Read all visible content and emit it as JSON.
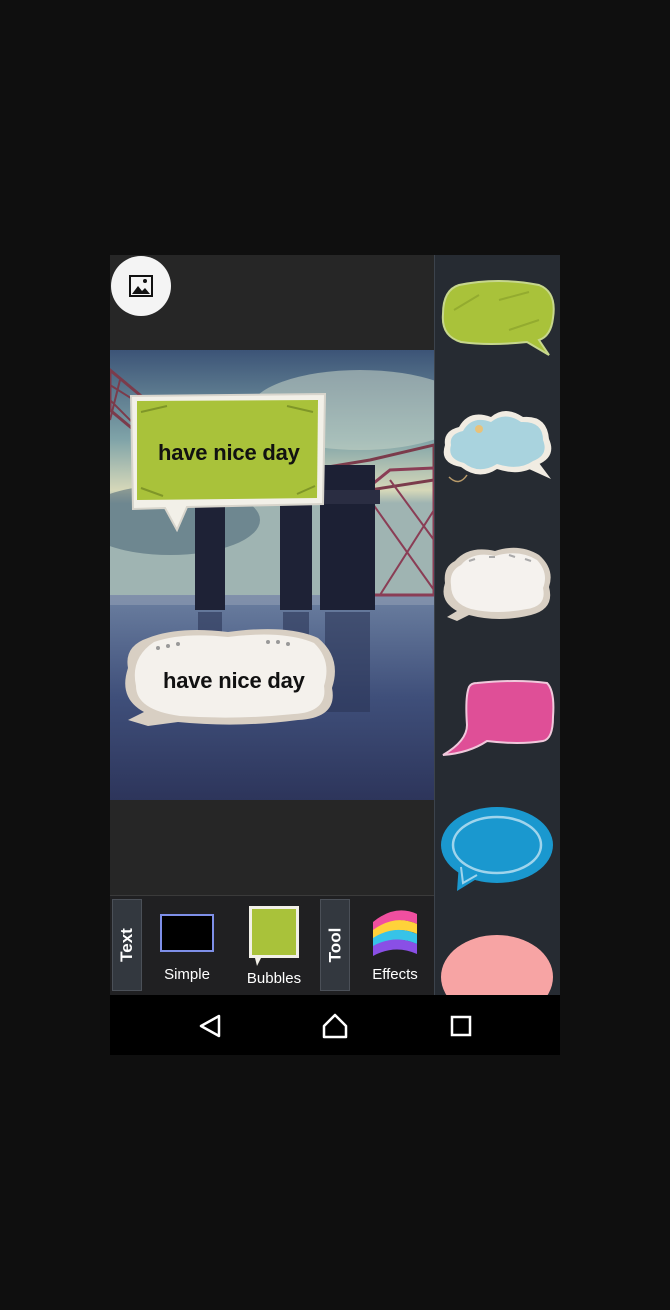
{
  "canvas": {
    "gallery_icon": "image-gallery-icon",
    "bubbles": [
      {
        "text": "have nice day",
        "style": "green-scribble-rectangle"
      },
      {
        "text": "have nice day",
        "style": "white-paper-cloud"
      }
    ]
  },
  "sticker_panel": {
    "items": [
      {
        "name": "green-rounded-bubble",
        "color": "#a9c23a"
      },
      {
        "name": "blue-cloud-bubble",
        "color": "#a9d3de"
      },
      {
        "name": "white-cloud-bubble",
        "color": "#f3f0ea"
      },
      {
        "name": "pink-bubble",
        "color": "#df4f97"
      },
      {
        "name": "blue-oval-bubble",
        "color": "#1a98cf"
      },
      {
        "name": "peach-oval-bubble",
        "color": "#f7a4a4"
      }
    ]
  },
  "toolbar": {
    "text_tab": "Text",
    "simple_label": "Simple",
    "bubbles_label": "Bubbles",
    "tool_tab": "Tool",
    "effects_label": "Effects"
  },
  "navbar": {
    "back_icon": "back-triangle-icon",
    "home_icon": "home-icon",
    "recents_icon": "recents-square-icon"
  }
}
